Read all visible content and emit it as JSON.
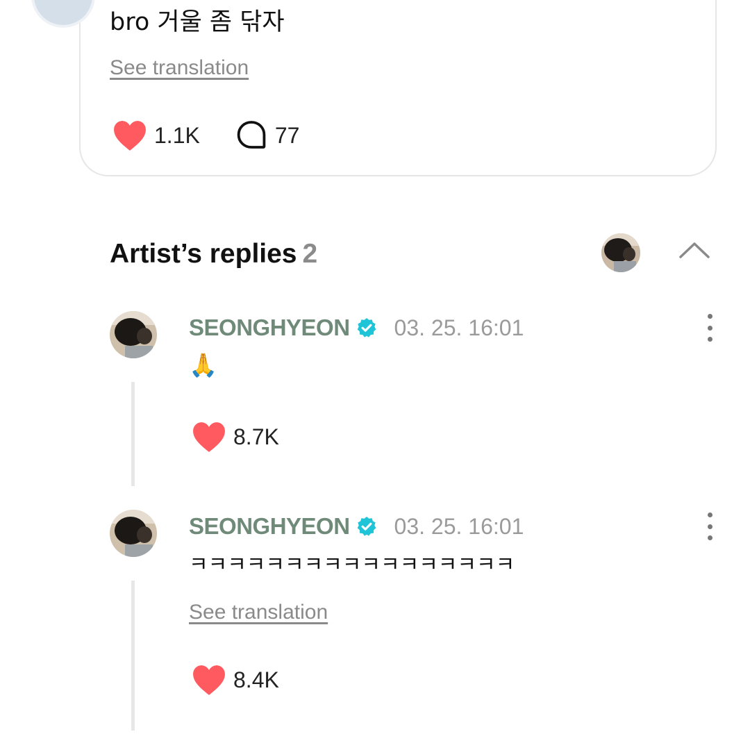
{
  "post": {
    "text": "bro 거울 좀 닦자",
    "see_translation": "See translation",
    "likes": "1.1K",
    "comments": "77",
    "like_icon": "heart-icon",
    "comment_icon": "comment-bubble-icon"
  },
  "artist_replies": {
    "title": "Artist’s replies",
    "count": "2",
    "collapse_icon": "chevron-up-icon",
    "replies": [
      {
        "author": "SEONGHYEON",
        "verified_icon": "verified-badge-icon",
        "time": "03. 25. 16:01",
        "text": "🙏",
        "likes": "8.7K"
      },
      {
        "author": "SEONGHYEON",
        "verified_icon": "verified-badge-icon",
        "time": "03. 25. 16:01",
        "text": "ㅋㅋㅋㅋㅋㅋㅋㅋㅋㅋㅋㅋㅋㅋㅋㅋㅋ",
        "see_translation": "See translation",
        "likes": "8.4K"
      }
    ]
  },
  "colors": {
    "heart": "#ff5a5f",
    "author": "#6f8a78",
    "verified": "#1fc4d6",
    "muted": "#9a9a9a",
    "thread_line": "#e7e7e7"
  }
}
